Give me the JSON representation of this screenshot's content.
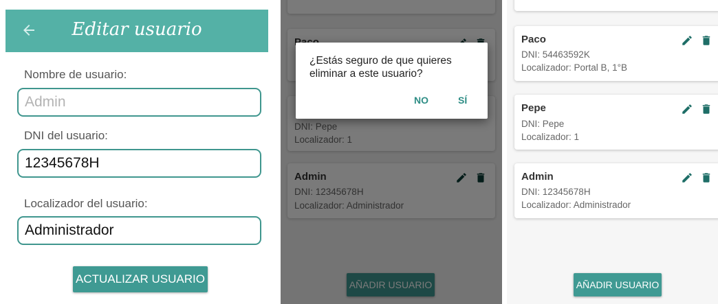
{
  "edit": {
    "title": "Editar usuario",
    "name_label": "Nombre de usuario:",
    "name_placeholder": "Admin",
    "dni_label": "DNI del usuario:",
    "dni_value": "12345678H",
    "loc_label": "Localizador del usuario:",
    "loc_value": "Administrador",
    "submit": "ACTUALIZAR USUARIO"
  },
  "dialog": {
    "message": "¿Estás seguro de que quieres eliminar a este usuario?",
    "no": "NO",
    "yes": "SÍ"
  },
  "users": [
    {
      "name": "Paco",
      "dni": "DNI: 54463592K",
      "loc": "Localizador: Portal B, 1°B"
    },
    {
      "name": "Pepe",
      "dni": "DNI: Pepe",
      "loc": "Localizador: 1"
    },
    {
      "name": "Admin",
      "dni": "DNI: 12345678H",
      "loc": "Localizador: Administrador"
    }
  ],
  "add_button": "AÑADIR USUARIO",
  "colors": {
    "primary": "#54b1a6",
    "button": "#3f9a93",
    "accent": "#2e8d85"
  }
}
